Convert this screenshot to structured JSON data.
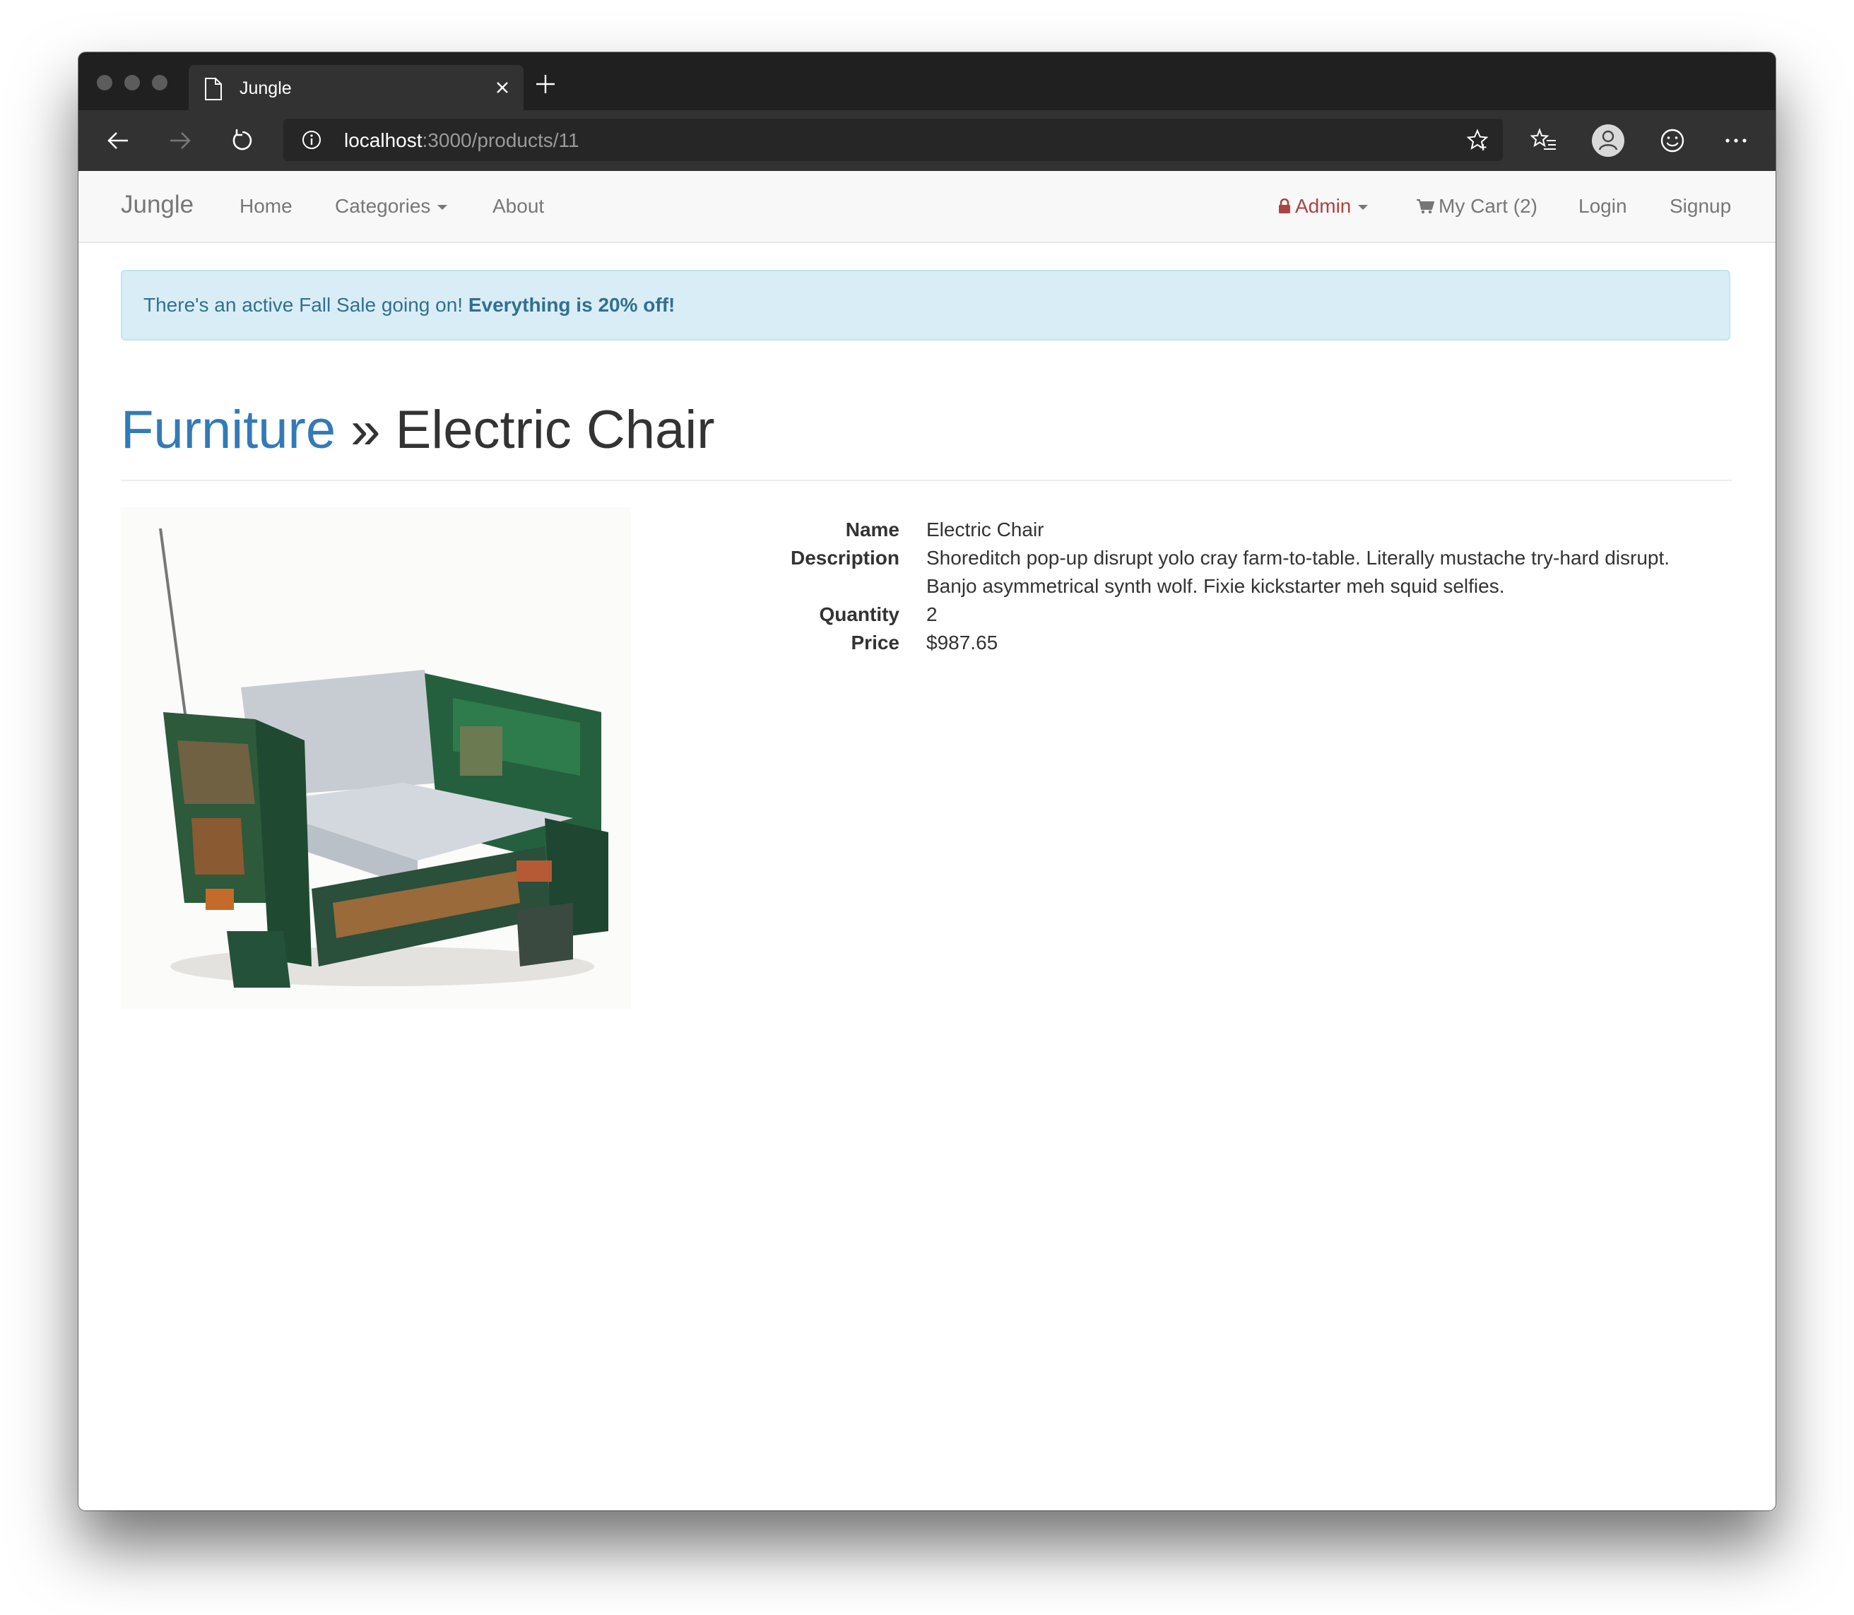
{
  "browser": {
    "tab_title": "Jungle",
    "url_host": "localhost",
    "url_path": ":3000/products/11"
  },
  "navbar": {
    "brand": "Jungle",
    "links": [
      "Home",
      "Categories",
      "About"
    ],
    "admin": "Admin",
    "cart": "My Cart (2)",
    "login": "Login",
    "signup": "Signup"
  },
  "alert": {
    "text": "There's an active Fall Sale going on! ",
    "emphasis": "Everything is 20% off!"
  },
  "header": {
    "category": "Furniture",
    "separator": " » ",
    "product": "Electric Chair"
  },
  "product": {
    "labels": {
      "name": "Name",
      "description": "Description",
      "quantity": "Quantity",
      "price": "Price"
    },
    "name": "Electric Chair",
    "description": "Shoreditch pop-up disrupt yolo cray farm-to-table. Literally mustache try-hard disrupt. Banjo asymmetrical synth wolf. Fixie kickstarter meh squid selfies.",
    "quantity": "2",
    "price": "$987.65"
  },
  "icons": {
    "back": "arrow-left-icon",
    "forward": "arrow-right-icon",
    "reload": "reload-icon",
    "info": "info-icon",
    "favorite": "star-icon",
    "favorites_list": "favorites-icon",
    "profile": "profile-icon",
    "feedback": "smiley-icon",
    "more": "more-icon",
    "lock": "lock-icon",
    "cart": "cart-icon"
  },
  "colors": {
    "link": "#337ab7",
    "admin": "#a94442",
    "alert_bg": "#d9edf7",
    "alert_text": "#31708f"
  }
}
